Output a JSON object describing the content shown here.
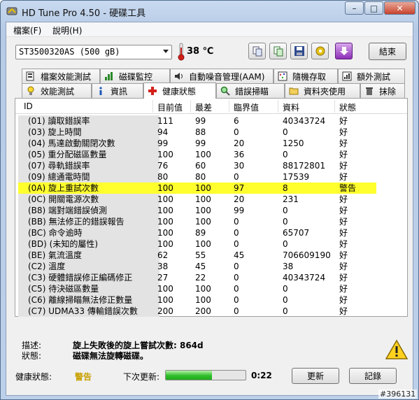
{
  "window": {
    "title": "HD Tune Pro 4.50 - 硬碟工具",
    "min": "–",
    "max": "□",
    "close": "✕"
  },
  "menu": [
    "檔案(F)",
    "說明(H)"
  ],
  "toolbar": {
    "drive": "ST3500320AS (500 gB)",
    "temperature": "38 ℃",
    "exit_label": "結束",
    "thermometer_color": "#d0201a"
  },
  "tabs_top": [
    {
      "label": "檔案效能測試",
      "icon": "file-benchmark-icon"
    },
    {
      "label": "磁碟監控",
      "icon": "disk-monitor-icon"
    },
    {
      "label": "自動噪音管理(AAM)",
      "icon": "speaker-icon"
    },
    {
      "label": "隨機存取",
      "icon": "random-access-icon"
    },
    {
      "label": "額外測試",
      "icon": "extra-tests-icon"
    }
  ],
  "tabs_bottom": [
    {
      "label": "效能測試",
      "icon": "lightbulb-icon"
    },
    {
      "label": "資訊",
      "icon": "info-icon"
    },
    {
      "label": "健康狀態",
      "icon": "health-cross-icon",
      "active": true
    },
    {
      "label": "錯誤掃瞄",
      "icon": "magnifier-icon"
    },
    {
      "label": "資料夾使用",
      "icon": "folder-icon"
    },
    {
      "label": "抹除",
      "icon": "trash-icon"
    }
  ],
  "table": {
    "headers": [
      "ID",
      "目前值",
      "最差",
      "臨界值",
      "資料",
      "狀態"
    ],
    "rows": [
      {
        "id": "(01) 讀取錯誤率",
        "current": "111",
        "worst": "99",
        "threshold": "6",
        "data": "40343724",
        "status": "好"
      },
      {
        "id": "(03) 旋上時間",
        "current": "94",
        "worst": "88",
        "threshold": "0",
        "data": "0",
        "status": "好"
      },
      {
        "id": "(04) 馬達啟動關閉次數",
        "current": "99",
        "worst": "99",
        "threshold": "20",
        "data": "1250",
        "status": "好"
      },
      {
        "id": "(05) 重分配磁區數量",
        "current": "100",
        "worst": "100",
        "threshold": "36",
        "data": "0",
        "status": "好"
      },
      {
        "id": "(07) 尋軌錯誤率",
        "current": "76",
        "worst": "60",
        "threshold": "30",
        "data": "88172801",
        "status": "好"
      },
      {
        "id": "(09) 總通電時間",
        "current": "80",
        "worst": "80",
        "threshold": "0",
        "data": "17539",
        "status": "好"
      },
      {
        "id": "(0A) 旋上重試次數",
        "current": "100",
        "worst": "100",
        "threshold": "97",
        "data": "8",
        "status": "警告",
        "highlight": true
      },
      {
        "id": "(0C) 開關電源次數",
        "current": "100",
        "worst": "100",
        "threshold": "20",
        "data": "231",
        "status": "好"
      },
      {
        "id": "(B8) 端對端錯誤偵測",
        "current": "100",
        "worst": "100",
        "threshold": "99",
        "data": "0",
        "status": "好"
      },
      {
        "id": "(BB) 無法修正的錯誤報告",
        "current": "100",
        "worst": "100",
        "threshold": "0",
        "data": "0",
        "status": "好"
      },
      {
        "id": "(BC) 命令逾時",
        "current": "100",
        "worst": "89",
        "threshold": "0",
        "data": "65707",
        "status": "好"
      },
      {
        "id": "(BD) (未知的屬性)",
        "current": "100",
        "worst": "100",
        "threshold": "0",
        "data": "0",
        "status": "好"
      },
      {
        "id": "(BE) 氣流溫度",
        "current": "62",
        "worst": "55",
        "threshold": "45",
        "data": "706609190",
        "status": "好"
      },
      {
        "id": "(C2) 溫度",
        "current": "38",
        "worst": "45",
        "threshold": "0",
        "data": "38",
        "status": "好"
      },
      {
        "id": "(C3) 硬體錯誤修正編碼修正",
        "current": "27",
        "worst": "22",
        "threshold": "0",
        "data": "40343724",
        "status": "好"
      },
      {
        "id": "(C5) 待決磁區數量",
        "current": "100",
        "worst": "100",
        "threshold": "0",
        "data": "0",
        "status": "好"
      },
      {
        "id": "(C6) 離線掃瞄無法修正數量",
        "current": "100",
        "worst": "100",
        "threshold": "0",
        "data": "0",
        "status": "好"
      },
      {
        "id": "(C7) UDMA33 傳輸錯誤次數",
        "current": "200",
        "worst": "200",
        "threshold": "0",
        "data": "0",
        "status": "好"
      }
    ]
  },
  "details": {
    "desc_label": "描述:",
    "desc_value": "旋上失敗後的旋上嘗試次數: 864d",
    "status_label": "狀態:",
    "status_value": "磁碟無法旋轉磁碟。"
  },
  "status": {
    "health_label": "健康狀態:",
    "health_value": "警告",
    "next_update_label": "下次更新:",
    "progress_fraction": 0.58,
    "timer": "0:22",
    "refresh_label": "更新",
    "log_label": "記錄"
  },
  "watermark": "#396131"
}
